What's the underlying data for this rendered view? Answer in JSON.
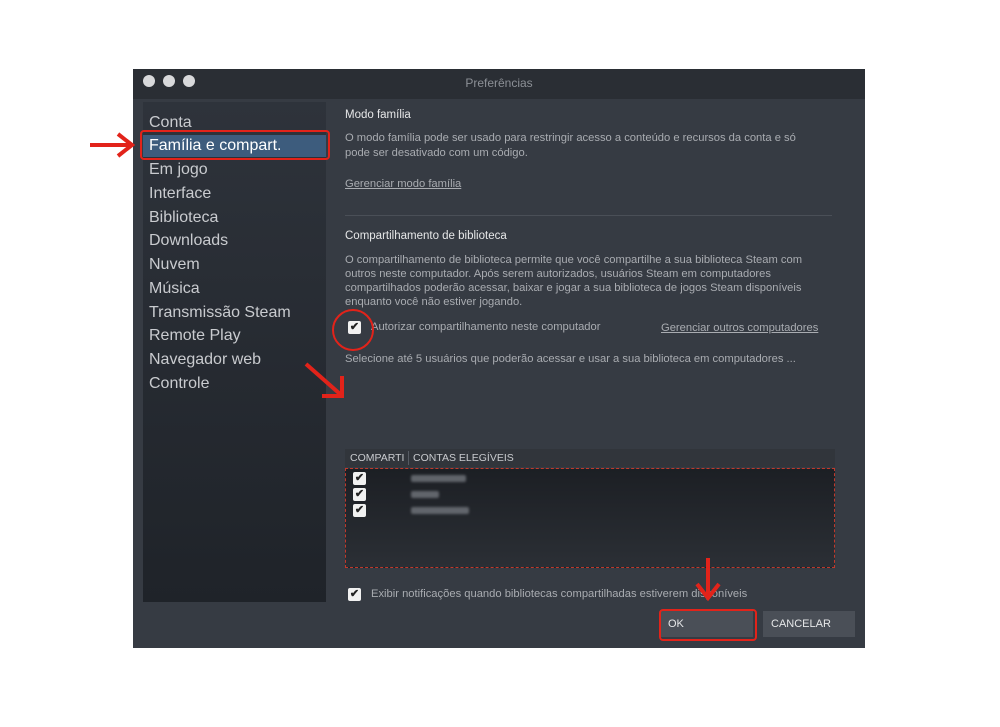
{
  "window": {
    "title": "Preferências"
  },
  "sidebar": {
    "items": [
      {
        "label": "Conta"
      },
      {
        "label": "Família e compart."
      },
      {
        "label": "Em jogo"
      },
      {
        "label": "Interface"
      },
      {
        "label": "Biblioteca"
      },
      {
        "label": "Downloads"
      },
      {
        "label": "Nuvem"
      },
      {
        "label": "Música"
      },
      {
        "label": "Transmissão Steam"
      },
      {
        "label": "Remote Play"
      },
      {
        "label": "Navegador web"
      },
      {
        "label": "Controle"
      }
    ],
    "active_index": 1
  },
  "family": {
    "heading": "Modo família",
    "desc_line1": "O modo família pode ser usado para restringir acesso a conteúdo e recursos da conta e só",
    "desc_line2": "pode ser desativado com um código.",
    "manage_link": "Gerenciar modo família"
  },
  "library_sharing": {
    "heading": "Compartilhamento de biblioteca",
    "desc_line1": "O compartilhamento de biblioteca permite que você compartilhe a sua biblioteca Steam com",
    "desc_line2": "outros neste computador. Após serem autorizados, usuários Steam em computadores",
    "desc_line3": "compartilhados poderão acessar, baixar e jogar a sua biblioteca de jogos Steam disponíveis",
    "desc_line4": "enquanto você não estiver jogando.",
    "authorize_label": "Autorizar compartilhamento neste computador",
    "authorize_checked": true,
    "manage_computers_link": "Gerenciar outros computadores",
    "select_users_text": "Selecione até 5 usuários que poderão acessar e usar a sua biblioteca em computadores ...",
    "columns": [
      "COMPARTI",
      "CONTAS ELEGÍVEIS"
    ],
    "accounts": [
      {
        "checked": true
      },
      {
        "checked": true
      },
      {
        "checked": true
      }
    ],
    "notify_label": "Exibir notificações quando bibliotecas compartilhadas estiverem disponíveis",
    "notify_checked": true
  },
  "footer": {
    "ok_label": "OK",
    "cancel_label": "CANCELAR"
  },
  "colors": {
    "annotation": "#e2231a",
    "active_item": "#3d5c7d",
    "window_bg": "#363b43"
  }
}
